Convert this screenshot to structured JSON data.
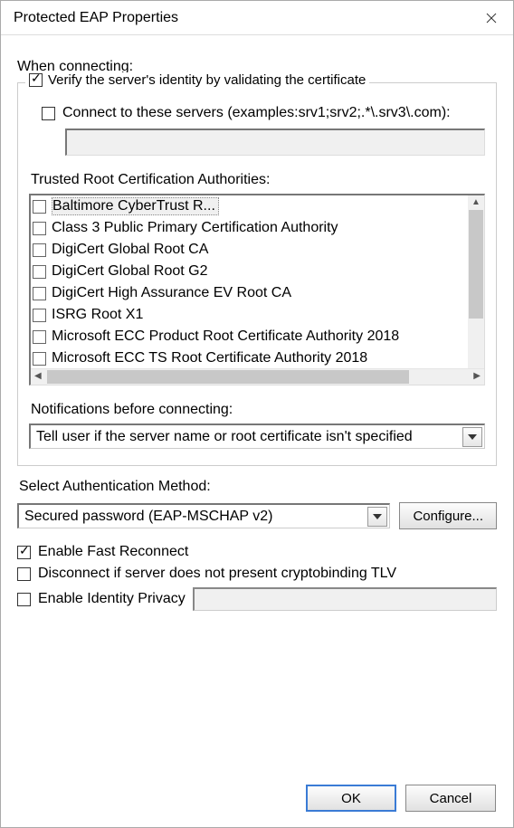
{
  "window": {
    "title": "Protected EAP Properties"
  },
  "connecting_label": "When connecting:",
  "verify_group": {
    "verify_checked": true,
    "verify_label": "Verify the server's identity by validating the certificate",
    "connect_servers_checked": false,
    "connect_servers_label": "Connect to these servers (examples:srv1;srv2;.*\\.srv3\\.com):",
    "servers_value": ""
  },
  "trusted_label": "Trusted Root Certification Authorities:",
  "trusted_roots": [
    {
      "checked": false,
      "label": "Baltimore CyberTrust R...",
      "highlighted": true
    },
    {
      "checked": false,
      "label": "Class 3 Public Primary Certification Authority"
    },
    {
      "checked": false,
      "label": "DigiCert Global Root CA"
    },
    {
      "checked": false,
      "label": "DigiCert Global Root G2"
    },
    {
      "checked": false,
      "label": "DigiCert High Assurance EV Root CA"
    },
    {
      "checked": false,
      "label": "ISRG Root X1"
    },
    {
      "checked": false,
      "label": "Microsoft ECC Product Root Certificate Authority 2018"
    },
    {
      "checked": false,
      "label": "Microsoft ECC TS Root Certificate Authority 2018"
    }
  ],
  "notifications_label": "Notifications before connecting:",
  "notifications_value": "Tell user if the server name or root certificate isn't specified",
  "auth_label": "Select Authentication Method:",
  "auth_value": "Secured password (EAP-MSCHAP v2)",
  "configure_btn": "Configure...",
  "fast_reconnect": {
    "checked": true,
    "label": "Enable Fast Reconnect"
  },
  "cryptobinding": {
    "checked": false,
    "label": "Disconnect if server does not present cryptobinding TLV"
  },
  "identity_privacy": {
    "checked": false,
    "label": "Enable Identity Privacy",
    "value": ""
  },
  "buttons": {
    "ok": "OK",
    "cancel": "Cancel"
  }
}
